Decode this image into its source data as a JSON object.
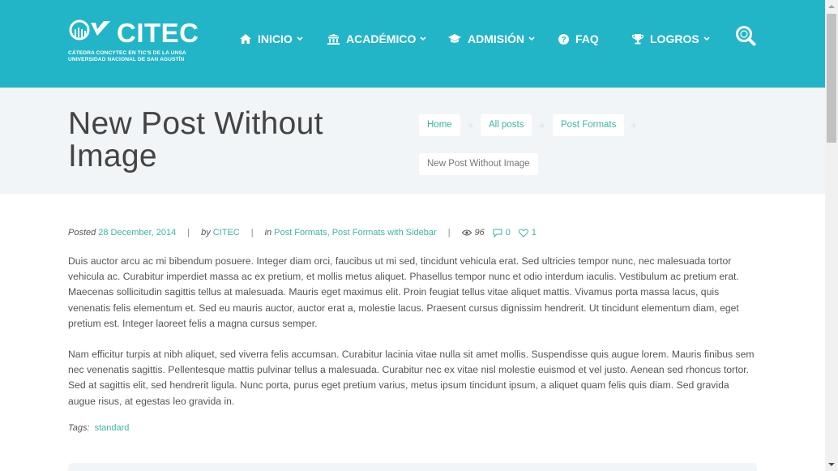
{
  "brand": {
    "name": "CITEC",
    "subtitle_line1": "CÁTEDRA CONCYTEC EN TIC'S DE LA UNSA",
    "subtitle_line2": "UNIVERSIDAD NACIONAL DE SAN AGUSTÍN"
  },
  "nav": {
    "items": [
      {
        "label": "INICIO",
        "icon": "home-icon",
        "dropdown": true
      },
      {
        "label": "ACADÉMICO",
        "icon": "bank-icon",
        "dropdown": true
      },
      {
        "label": "ADMISIÓN",
        "icon": "graduation-cap-icon",
        "dropdown": true
      },
      {
        "label": "FAQ",
        "icon": "question-circle-icon",
        "dropdown": false
      },
      {
        "label": "LOGROS",
        "icon": "trophy-icon",
        "dropdown": true
      }
    ],
    "search_icon": "search-icon"
  },
  "page": {
    "title": "New Post Without Image"
  },
  "breadcrumb": {
    "items": [
      "Home",
      "All posts",
      "Post Formats"
    ],
    "current": "New Post Without Image"
  },
  "post": {
    "meta": {
      "posted_label": "Posted",
      "date": "28 December, 2014",
      "by_label": "by",
      "author": "CITEC",
      "in_label": "in",
      "categories": "Post Formats, Post Formats with Sidebar",
      "views": "96",
      "comments": "0",
      "likes": "1"
    },
    "paragraph1": "Duis auctor arcu ac mi bibendum posuere. Integer diam orci, faucibus ut mi sed, tincidunt vehicula erat. Sed ultricies tempor nunc, nec malesuada tortor vehicula ac. Curabitur imperdiet massa ac ex pretium, et mollis metus aliquet. Phasellus tempor nunc et odio interdum iaculis. Vestibulum ac pretium erat. Maecenas sollicitudin sagittis tellus at malesuada. Mauris eget maximus elit. Proin feugiat tellus vitae aliquet mattis. Vivamus porta massa lacus, quis venenatis felis elementum et. Sed eu mauris auctor, auctor erat a, molestie lacus. Praesent cursus dignissim hendrerit. Ut tincidunt elementum diam, eget pretium est. Integer laoreet felis a magna cursus semper.",
    "paragraph2": "Nam efficitur turpis at nibh aliquet, sed viverra felis accumsan. Curabitur lacinia vitae nulla sit amet mollis. Suspendisse quis augue lorem. Mauris finibus sem nec venenatis sagittis. Pellentesque mattis pulvinar tellus a malesuada. Curabitur nec ex vitae nisl molestie euismod et vel justo. Aenean sed rhoncus tortor. Sed at sagittis elit, sed hendrerit ligula. Nunc porta, purus eget pretium varius, metus ipsum tincidunt ipsum, a aliquet quam felis quis diam. Sed gravida augue risus, at egestas leo gravida in.",
    "tags_label": "Tags:",
    "tag": "standard"
  },
  "colors": {
    "header_bg": "#22b5c8",
    "link": "#3fb3a4",
    "band_bg": "#f1f5f7"
  }
}
